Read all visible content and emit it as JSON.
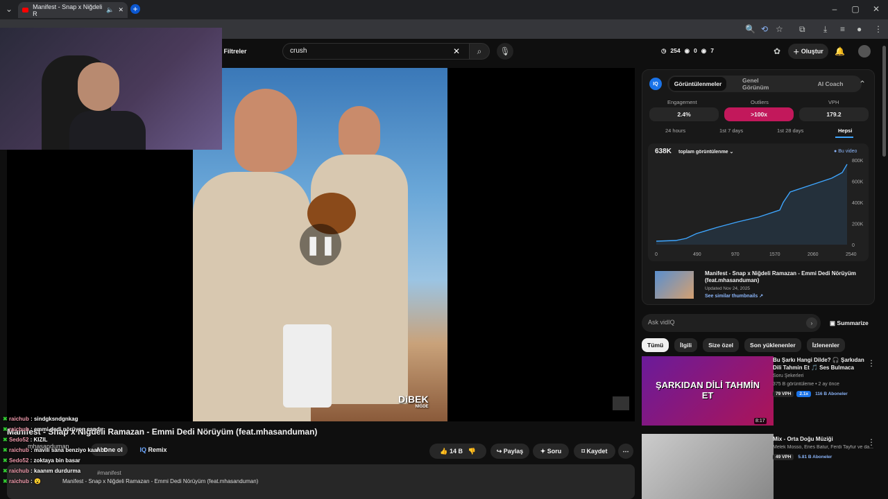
{
  "tab": {
    "title": "Manifest - Snap x Niğdeli R"
  },
  "search": {
    "query": "crush"
  },
  "filters": "Filtreler",
  "stats": {
    "views": "254",
    "a": "0",
    "b": "7"
  },
  "create": "Oluştur",
  "video": {
    "title": "Manifest - Snap x Niğdeli Ramazan - Emmi Dedi Nörüyüm (feat.mhasanduman)",
    "channel": "mhasanduman",
    "subscribe": "Abone ol",
    "remix": "Remix",
    "likes": "14 B",
    "share": "Paylaş",
    "ask": "Soru",
    "save": "Kaydet",
    "watermark": "DiBEK",
    "watermark2": "NİĞDE",
    "hashtags": "#manifest",
    "desc": "Manifest - Snap x Niğdeli Ramazan - Emmi Dedi Nörüyüm (feat.mhasanduman)"
  },
  "vidiq": {
    "tabs": [
      "Görüntülenmeler",
      "Genel Görünüm",
      "AI Coach"
    ],
    "metrics": [
      {
        "label": "Engagement",
        "value": "2.4%"
      },
      {
        "label": "Outliers",
        "value": ">100x"
      },
      {
        "label": "VPH",
        "value": "179.2"
      }
    ],
    "ranges": [
      "24 hours",
      "1st 7 days",
      "1st 28 days",
      "Hepsi"
    ],
    "total": "638K",
    "total_label": "toplam görüntülenme",
    "legend": "Bu video",
    "y_ticks": [
      "800K",
      "600K",
      "400K",
      "200K",
      "0"
    ],
    "x_ticks": [
      "0",
      "490",
      "970",
      "1570",
      "2060",
      "2540"
    ],
    "thumb_title": "Manifest - Snap x Niğdeli Ramazan - Emmi Dedi Nörüyüm (feat.mhasanduman)",
    "updated": "Updated Nov 24, 2025",
    "similar": "See similar thumbnails ↗"
  },
  "ask": {
    "placeholder": "Ask vidIQ",
    "summarize": "Summarize"
  },
  "chips": [
    "Tümü",
    "İlgili",
    "Size özel",
    "Son yüklenenler",
    "İzlenenler"
  ],
  "recs": [
    {
      "title": "Bu Şarkı Hangi Dilde? 🎧 Şarkıdan Dili Tahmin Et 🎵 Ses Bulmaca",
      "channel": "Soru Şekerleri",
      "meta": "375 B görüntüleme • 2 ay önce",
      "vph": "79 VPH",
      "mult": "2.1x",
      "subs": "116 B Aboneler",
      "duration": "8:17",
      "thumb_text": "ŞARKIDAN DİLİ TAHMİN ET"
    },
    {
      "title": "Mix - Orta Doğu Müziği",
      "channel": "Melek Mosso, Enes Batur, Ferdi Tayfur ve da...",
      "vph": "49 VPH",
      "subs": "5.81 B Aboneler"
    }
  ],
  "chat": [
    {
      "user": "raichub",
      "msg": "sindgksndgnkag"
    },
    {
      "user": "raichub",
      "msg": "emmi dedi nörüyon candır"
    },
    {
      "user": "Sedo52",
      "msg": "KIZIL"
    },
    {
      "user": "raichub",
      "msg": "mavili sana benziyo kaan :D"
    },
    {
      "user": "Sedo52",
      "msg": "zoktaya bin basar"
    },
    {
      "user": "raichub",
      "msg": "kaanım durdurma"
    },
    {
      "user": "raichub",
      "msg": "😮"
    }
  ]
}
